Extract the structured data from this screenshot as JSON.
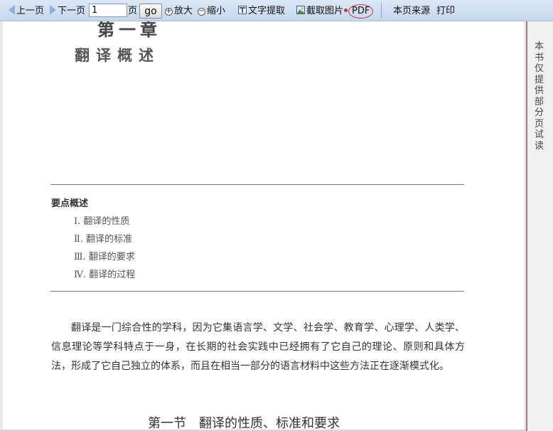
{
  "toolbar": {
    "prev_label": "上一页",
    "next_label": "下一页",
    "page_value": "1",
    "page_suffix": "页",
    "go_label": "go",
    "zoom_in_label": "放大",
    "zoom_out_label": "缩小",
    "extract_text_label": "文字提取",
    "capture_image_label": "截取图片",
    "pdf_label": "PDF",
    "source_label": "本页来源",
    "print_label": "打印"
  },
  "document": {
    "chapter_number": "第一章",
    "chapter_title": "翻译概述",
    "key_points_heading": "要点概述",
    "key_points": [
      "Ⅰ. 翻译的性质",
      "Ⅱ. 翻译的标准",
      "Ⅲ. 翻译的要求",
      "Ⅳ. 翻译的过程"
    ],
    "paragraph": "翻译是一门综合性的学科，因为它集语言学、文学、社会学、教育学、心理学、人类学、信息理论等学科特点于一身，在长期的社会实践中已经拥有了它自己的理论、原则和具体方法，形成了它自己独立的体系，而且在相当一部分的语言材料中这些方法正在逐渐模式化。",
    "section_title": "第一节　翻译的性质、标准和要求"
  },
  "side_panel": {
    "notice": "本书仅提供部分页试读"
  },
  "colors": {
    "toolbar_bg": "#c6d8ee",
    "pdf_circle": "#d03030"
  }
}
